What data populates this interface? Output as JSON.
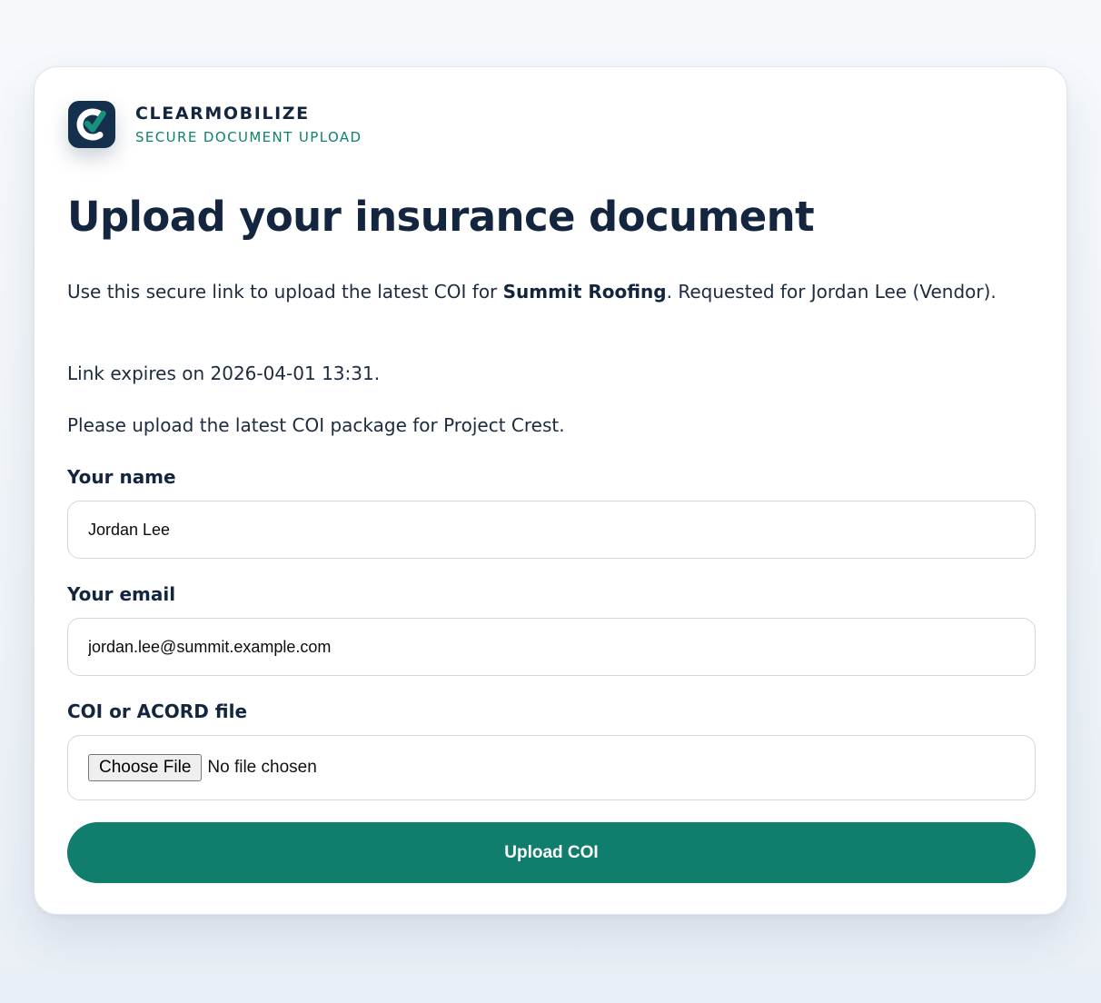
{
  "brand": {
    "name": "CLEARMOBILIZE",
    "subtitle": "SECURE DOCUMENT UPLOAD",
    "logo_icon": "checkmark-c-logo-icon",
    "colors": {
      "logo_bg": "#14304c",
      "logo_check": "#16917d",
      "accent": "#12806e"
    }
  },
  "page": {
    "title": "Upload your insurance document",
    "intro_before": "Use this secure link to upload the latest COI for ",
    "company": "Summit Roofing",
    "intro_after": ". Requested for Jordan Lee (Vendor).",
    "expiry": "Link expires on 2026-04-01 13:31.",
    "message": "Please upload the latest COI package for Project Crest."
  },
  "form": {
    "name_label": "Your name",
    "name_value": "Jordan Lee",
    "email_label": "Your email",
    "email_value": "jordan.lee@summit.example.com",
    "file_label": "COI or ACORD file",
    "choose_file_label": "Choose File",
    "no_file_text": "No file chosen",
    "submit_label": "Upload COI",
    "submit_color": "#117d6d"
  }
}
